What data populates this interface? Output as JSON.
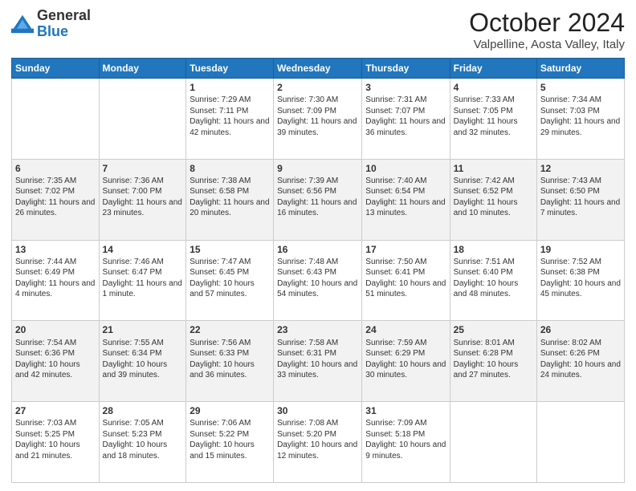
{
  "logo": {
    "general": "General",
    "blue": "Blue"
  },
  "header": {
    "month": "October 2024",
    "location": "Valpelline, Aosta Valley, Italy"
  },
  "days_of_week": [
    "Sunday",
    "Monday",
    "Tuesday",
    "Wednesday",
    "Thursday",
    "Friday",
    "Saturday"
  ],
  "weeks": [
    [
      {
        "day": "",
        "sunrise": "",
        "sunset": "",
        "daylight": ""
      },
      {
        "day": "",
        "sunrise": "",
        "sunset": "",
        "daylight": ""
      },
      {
        "day": "1",
        "sunrise": "Sunrise: 7:29 AM",
        "sunset": "Sunset: 7:11 PM",
        "daylight": "Daylight: 11 hours and 42 minutes."
      },
      {
        "day": "2",
        "sunrise": "Sunrise: 7:30 AM",
        "sunset": "Sunset: 7:09 PM",
        "daylight": "Daylight: 11 hours and 39 minutes."
      },
      {
        "day": "3",
        "sunrise": "Sunrise: 7:31 AM",
        "sunset": "Sunset: 7:07 PM",
        "daylight": "Daylight: 11 hours and 36 minutes."
      },
      {
        "day": "4",
        "sunrise": "Sunrise: 7:33 AM",
        "sunset": "Sunset: 7:05 PM",
        "daylight": "Daylight: 11 hours and 32 minutes."
      },
      {
        "day": "5",
        "sunrise": "Sunrise: 7:34 AM",
        "sunset": "Sunset: 7:03 PM",
        "daylight": "Daylight: 11 hours and 29 minutes."
      }
    ],
    [
      {
        "day": "6",
        "sunrise": "Sunrise: 7:35 AM",
        "sunset": "Sunset: 7:02 PM",
        "daylight": "Daylight: 11 hours and 26 minutes."
      },
      {
        "day": "7",
        "sunrise": "Sunrise: 7:36 AM",
        "sunset": "Sunset: 7:00 PM",
        "daylight": "Daylight: 11 hours and 23 minutes."
      },
      {
        "day": "8",
        "sunrise": "Sunrise: 7:38 AM",
        "sunset": "Sunset: 6:58 PM",
        "daylight": "Daylight: 11 hours and 20 minutes."
      },
      {
        "day": "9",
        "sunrise": "Sunrise: 7:39 AM",
        "sunset": "Sunset: 6:56 PM",
        "daylight": "Daylight: 11 hours and 16 minutes."
      },
      {
        "day": "10",
        "sunrise": "Sunrise: 7:40 AM",
        "sunset": "Sunset: 6:54 PM",
        "daylight": "Daylight: 11 hours and 13 minutes."
      },
      {
        "day": "11",
        "sunrise": "Sunrise: 7:42 AM",
        "sunset": "Sunset: 6:52 PM",
        "daylight": "Daylight: 11 hours and 10 minutes."
      },
      {
        "day": "12",
        "sunrise": "Sunrise: 7:43 AM",
        "sunset": "Sunset: 6:50 PM",
        "daylight": "Daylight: 11 hours and 7 minutes."
      }
    ],
    [
      {
        "day": "13",
        "sunrise": "Sunrise: 7:44 AM",
        "sunset": "Sunset: 6:49 PM",
        "daylight": "Daylight: 11 hours and 4 minutes."
      },
      {
        "day": "14",
        "sunrise": "Sunrise: 7:46 AM",
        "sunset": "Sunset: 6:47 PM",
        "daylight": "Daylight: 11 hours and 1 minute."
      },
      {
        "day": "15",
        "sunrise": "Sunrise: 7:47 AM",
        "sunset": "Sunset: 6:45 PM",
        "daylight": "Daylight: 10 hours and 57 minutes."
      },
      {
        "day": "16",
        "sunrise": "Sunrise: 7:48 AM",
        "sunset": "Sunset: 6:43 PM",
        "daylight": "Daylight: 10 hours and 54 minutes."
      },
      {
        "day": "17",
        "sunrise": "Sunrise: 7:50 AM",
        "sunset": "Sunset: 6:41 PM",
        "daylight": "Daylight: 10 hours and 51 minutes."
      },
      {
        "day": "18",
        "sunrise": "Sunrise: 7:51 AM",
        "sunset": "Sunset: 6:40 PM",
        "daylight": "Daylight: 10 hours and 48 minutes."
      },
      {
        "day": "19",
        "sunrise": "Sunrise: 7:52 AM",
        "sunset": "Sunset: 6:38 PM",
        "daylight": "Daylight: 10 hours and 45 minutes."
      }
    ],
    [
      {
        "day": "20",
        "sunrise": "Sunrise: 7:54 AM",
        "sunset": "Sunset: 6:36 PM",
        "daylight": "Daylight: 10 hours and 42 minutes."
      },
      {
        "day": "21",
        "sunrise": "Sunrise: 7:55 AM",
        "sunset": "Sunset: 6:34 PM",
        "daylight": "Daylight: 10 hours and 39 minutes."
      },
      {
        "day": "22",
        "sunrise": "Sunrise: 7:56 AM",
        "sunset": "Sunset: 6:33 PM",
        "daylight": "Daylight: 10 hours and 36 minutes."
      },
      {
        "day": "23",
        "sunrise": "Sunrise: 7:58 AM",
        "sunset": "Sunset: 6:31 PM",
        "daylight": "Daylight: 10 hours and 33 minutes."
      },
      {
        "day": "24",
        "sunrise": "Sunrise: 7:59 AM",
        "sunset": "Sunset: 6:29 PM",
        "daylight": "Daylight: 10 hours and 30 minutes."
      },
      {
        "day": "25",
        "sunrise": "Sunrise: 8:01 AM",
        "sunset": "Sunset: 6:28 PM",
        "daylight": "Daylight: 10 hours and 27 minutes."
      },
      {
        "day": "26",
        "sunrise": "Sunrise: 8:02 AM",
        "sunset": "Sunset: 6:26 PM",
        "daylight": "Daylight: 10 hours and 24 minutes."
      }
    ],
    [
      {
        "day": "27",
        "sunrise": "Sunrise: 7:03 AM",
        "sunset": "Sunset: 5:25 PM",
        "daylight": "Daylight: 10 hours and 21 minutes."
      },
      {
        "day": "28",
        "sunrise": "Sunrise: 7:05 AM",
        "sunset": "Sunset: 5:23 PM",
        "daylight": "Daylight: 10 hours and 18 minutes."
      },
      {
        "day": "29",
        "sunrise": "Sunrise: 7:06 AM",
        "sunset": "Sunset: 5:22 PM",
        "daylight": "Daylight: 10 hours and 15 minutes."
      },
      {
        "day": "30",
        "sunrise": "Sunrise: 7:08 AM",
        "sunset": "Sunset: 5:20 PM",
        "daylight": "Daylight: 10 hours and 12 minutes."
      },
      {
        "day": "31",
        "sunrise": "Sunrise: 7:09 AM",
        "sunset": "Sunset: 5:18 PM",
        "daylight": "Daylight: 10 hours and 9 minutes."
      },
      {
        "day": "",
        "sunrise": "",
        "sunset": "",
        "daylight": ""
      },
      {
        "day": "",
        "sunrise": "",
        "sunset": "",
        "daylight": ""
      }
    ]
  ]
}
